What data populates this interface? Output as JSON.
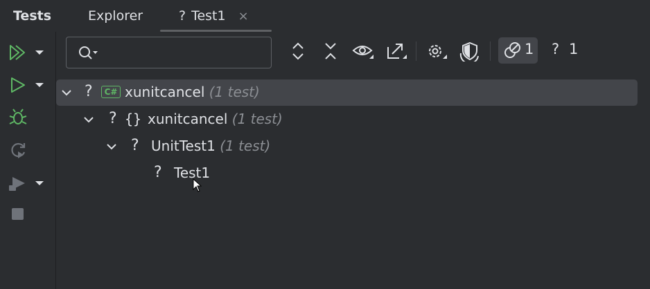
{
  "tabs": {
    "title": "Tests",
    "explorer": "Explorer",
    "active": {
      "icon": "?",
      "label": "Test1",
      "close": "×"
    }
  },
  "search": {
    "placeholder": "",
    "value": ""
  },
  "toolbar": {
    "ignored_count": "1",
    "unknown_icon": "?",
    "unknown_count": "1"
  },
  "tree": {
    "rows": [
      {
        "status": "?",
        "badge": "C#",
        "label": "xunitcancel",
        "meta": "(1 test)"
      },
      {
        "status": "?",
        "ns": "{}",
        "label": "xunitcancel",
        "meta": "(1 test)"
      },
      {
        "status": "?",
        "label": "UnitTest1",
        "meta": "(1 test)"
      },
      {
        "status": "?",
        "label": "Test1"
      }
    ]
  },
  "colors": {
    "background": "#2b2d30",
    "selection": "#43454a",
    "accent_green": "#5fb865",
    "text": "#dfe1e5",
    "muted": "#8c8f94"
  },
  "icons": [
    "run-all-icon",
    "run-icon",
    "debug-icon",
    "rerun-icon",
    "coverage-icon",
    "stop-icon",
    "search-icon",
    "expand-all-icon",
    "collapse-all-icon",
    "eye-icon",
    "export-icon",
    "gear-icon",
    "shield-icon",
    "ignored-tests-icon",
    "chevron-down-icon"
  ]
}
